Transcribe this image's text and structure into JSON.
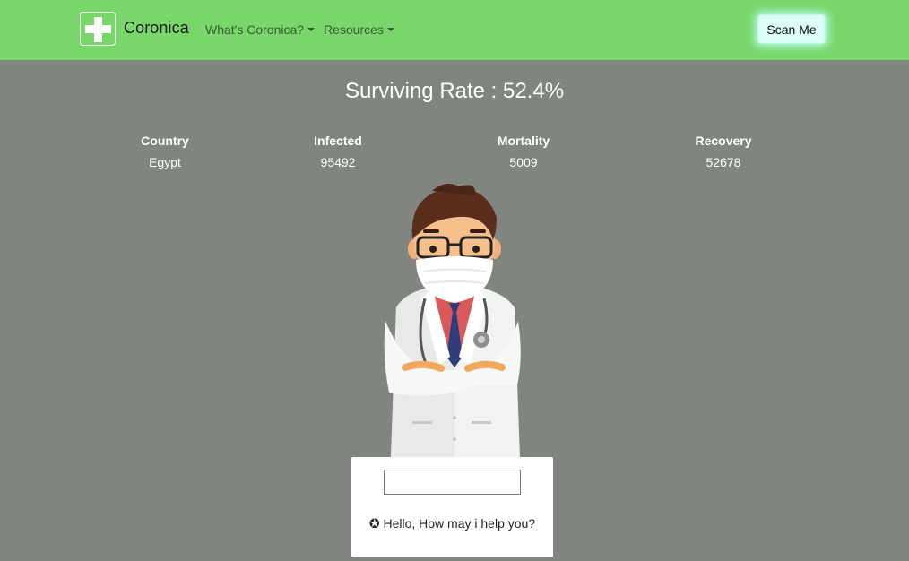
{
  "navbar": {
    "brand": "Coronica",
    "menu": [
      {
        "label": "What's Coronica?"
      },
      {
        "label": "Resources"
      }
    ],
    "scan_button": "Scan Me",
    "bg_color": "#79d66a"
  },
  "surviving_rate": "Surviving Rate : 52.4%",
  "stats": {
    "headers": [
      "Country",
      "Infected",
      "Mortality",
      "Recovery"
    ],
    "values": [
      "Egypt",
      "95492",
      "5009",
      "52678"
    ]
  },
  "chat": {
    "input_value": "",
    "greeting_icon": "star-circle-icon",
    "greeting": "✪ Hello, How may i help you?"
  },
  "illustration": "doctor-with-mask-icon",
  "page_bg_color": "#818580"
}
